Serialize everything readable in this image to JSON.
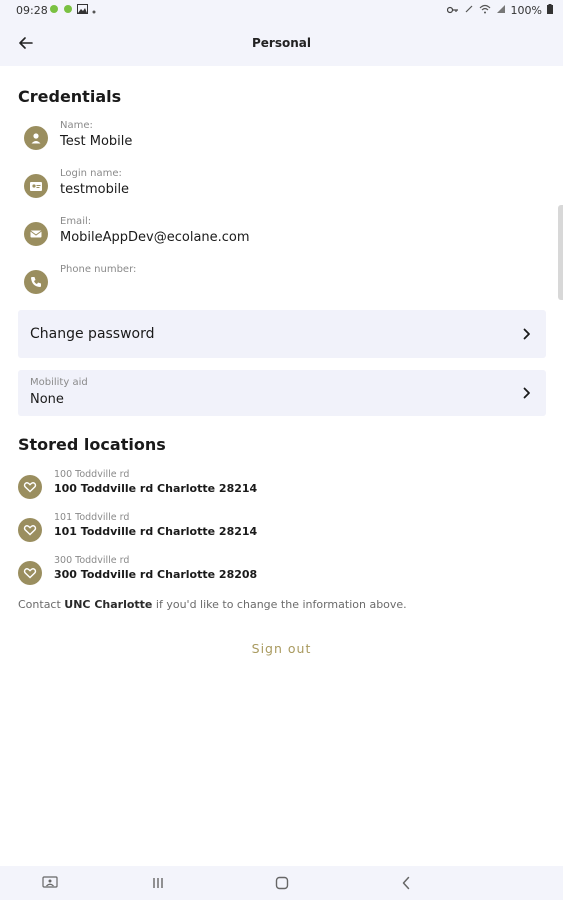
{
  "status_bar": {
    "time": "09:28",
    "battery": "100%"
  },
  "app_bar": {
    "title": "Personal"
  },
  "credentials": {
    "heading": "Credentials",
    "name": {
      "label": "Name:",
      "value": "Test Mobile"
    },
    "login": {
      "label": "Login name:",
      "value": "testmobile"
    },
    "email": {
      "label": "Email:",
      "value": "MobileAppDev@ecolane.com"
    },
    "phone": {
      "label": "Phone number:",
      "value": ""
    }
  },
  "change_password": {
    "label": "Change password"
  },
  "mobility_aid": {
    "label": "Mobility aid",
    "value": "None"
  },
  "stored_locations": {
    "heading": "Stored locations",
    "items": [
      {
        "name": "100 Toddville rd",
        "address": "100 Toddville rd Charlotte 28214"
      },
      {
        "name": "101 Toddville rd",
        "address": "101 Toddville rd Charlotte 28214"
      },
      {
        "name": "300 Toddville rd",
        "address": "300 Toddville rd Charlotte 28208"
      }
    ]
  },
  "contact": {
    "prefix": "Contact ",
    "org": "UNC Charlotte",
    "suffix": " if you'd like to change the information above."
  },
  "sign_out": {
    "label": "Sign out"
  },
  "colors": {
    "accent": "#9a8e5f",
    "header_bg": "#f3f4fb",
    "card_bg": "#f1f2fa"
  },
  "icons": {
    "name": "person-icon",
    "login": "id-card-icon",
    "email": "envelope-icon",
    "phone": "phone-icon",
    "location": "heart-icon",
    "back": "arrow-left-icon",
    "chevron": "chevron-right-icon"
  }
}
